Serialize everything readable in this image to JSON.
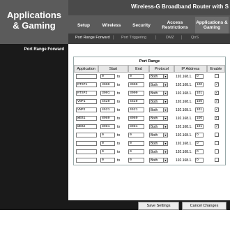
{
  "section": {
    "line1": "Applications",
    "line2": "& Gaming"
  },
  "product": "Wireless-G Broadband Router with S",
  "tabs": [
    {
      "label": "Setup"
    },
    {
      "label": "Wireless"
    },
    {
      "label": "Security"
    },
    {
      "label": "Access Restrictions"
    },
    {
      "label": "Applications & Gaming"
    }
  ],
  "subtabs": [
    {
      "label": "Port Range Forward"
    },
    {
      "label": "Port Triggering"
    },
    {
      "label": "DMZ"
    },
    {
      "label": "QoS"
    }
  ],
  "left": {
    "label": "Port Range Forward"
  },
  "table": {
    "title": "Port Range",
    "columns": [
      "Application",
      "Start",
      "End",
      "Protocol",
      "IP Address",
      "Enable"
    ],
    "ip_prefix": "192.168.1.",
    "to_label": "to",
    "rows": [
      {
        "app": "",
        "start": "0",
        "end": "0",
        "protocol": "Both",
        "ip": "0",
        "enabled": ""
      },
      {
        "app": "RTSP1",
        "start": "3000",
        "end": "3000",
        "protocol": "Both",
        "ip": "100",
        "enabled": "✓"
      },
      {
        "app": "RTSP2",
        "start": "3001",
        "end": "3000",
        "protocol": "Both",
        "ip": "101",
        "enabled": "✓"
      },
      {
        "app": "VNP1",
        "start": "4520",
        "end": "4520",
        "protocol": "Both",
        "ip": "100",
        "enabled": "✓"
      },
      {
        "app": "VNP2",
        "start": "4521",
        "end": "4521",
        "protocol": "Both",
        "ip": "101",
        "enabled": "✓"
      },
      {
        "app": "WEB1",
        "start": "8080",
        "end": "8080",
        "protocol": "Both",
        "ip": "100",
        "enabled": "✓"
      },
      {
        "app": "WEB2",
        "start": "8081",
        "end": "8081",
        "protocol": "Both",
        "ip": "101",
        "enabled": "✓"
      },
      {
        "app": "",
        "start": "0",
        "end": "0",
        "protocol": "Both",
        "ip": "0",
        "enabled": ""
      },
      {
        "app": "",
        "start": "0",
        "end": "0",
        "protocol": "Both",
        "ip": "0",
        "enabled": ""
      },
      {
        "app": "",
        "start": "0",
        "end": "0",
        "protocol": "Both",
        "ip": "0",
        "enabled": ""
      },
      {
        "app": "",
        "start": "0",
        "end": "0",
        "protocol": "Both",
        "ip": "0",
        "enabled": ""
      }
    ]
  },
  "footer": {
    "save": "Save Settings",
    "cancel": "Cancel Changes"
  }
}
